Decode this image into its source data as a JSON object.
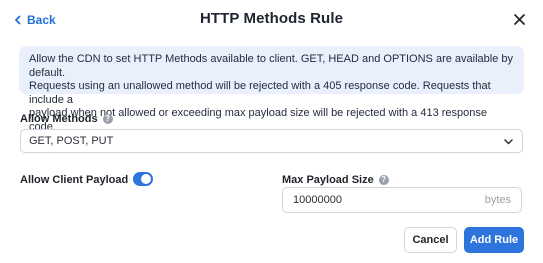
{
  "header": {
    "back_label": "Back",
    "title": "HTTP Methods Rule"
  },
  "info": {
    "line1": "Allow the CDN to set HTTP Methods available to client. GET, HEAD and OPTIONS are available by default.",
    "line2": "Requests using an unallowed method will be rejected with a 405 response code. Requests that include a",
    "line3": "payload when not allowed or exceeding max payload size will be rejected with a 413 response code."
  },
  "allow_methods": {
    "label": "Allow Methods",
    "help": "?",
    "selected": "GET, POST, PUT"
  },
  "allow_client_payload": {
    "label": "Allow Client Payload",
    "help": "?",
    "enabled": true
  },
  "max_payload_size": {
    "label": "Max Payload Size",
    "help": "?",
    "value": "10000000",
    "unit": "bytes"
  },
  "actions": {
    "cancel_label": "Cancel",
    "add_label": "Add Rule"
  },
  "colors": {
    "accent": "#2f73dd",
    "info_bg": "#e9f0fb"
  }
}
